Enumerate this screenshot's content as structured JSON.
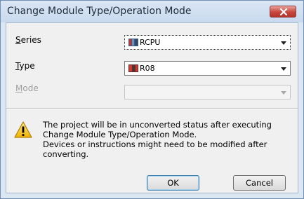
{
  "window": {
    "title": "Change Module Type/Operation Mode"
  },
  "form": {
    "series": {
      "label_accel": "S",
      "label_rest": "eries",
      "value": "RCPU",
      "icon": "module-icon"
    },
    "type": {
      "label_accel": "T",
      "label_rest": "ype",
      "value": "R08",
      "icon": "cpu-module-icon"
    },
    "mode": {
      "label_accel": "M",
      "label_rest": "ode",
      "value": ""
    }
  },
  "message": {
    "icon": "warning-icon",
    "lines": [
      "The project will be in unconverted status after executing",
      "Change Module Type/Operation Mode.",
      "Devices or instructions might need to be modified after",
      "converting."
    ]
  },
  "buttons": {
    "ok": "OK",
    "cancel": "Cancel"
  },
  "colors": {
    "close_button": "#c8463d",
    "title_bar": "#dbe6f4",
    "warning": "#f4c20d"
  }
}
